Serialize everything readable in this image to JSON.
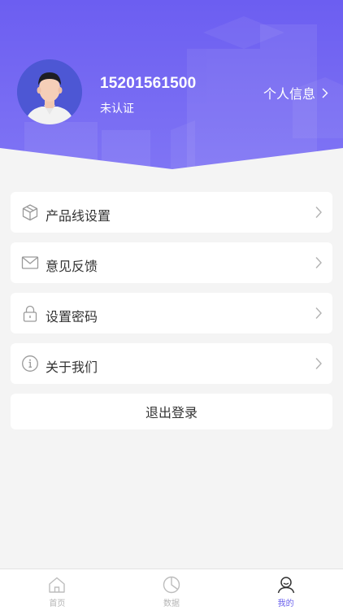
{
  "colors": {
    "accent": "#6a61ec",
    "header_top": "#6f61f2",
    "header_bottom": "#7c72f3"
  },
  "profile": {
    "phone": "15201561500",
    "status": "未认证",
    "info_link": "个人信息",
    "avatar_icon": "avatar"
  },
  "menu": {
    "items": [
      {
        "label": "产品线设置",
        "icon": "cube-icon"
      },
      {
        "label": "意见反馈",
        "icon": "mail-icon"
      },
      {
        "label": "设置密码",
        "icon": "lock-icon"
      },
      {
        "label": "关于我们",
        "icon": "info-icon"
      }
    ]
  },
  "logout_label": "退出登录",
  "tabbar": {
    "tabs": [
      {
        "label": "首页",
        "icon": "home-icon",
        "active": false
      },
      {
        "label": "数据",
        "icon": "pie-chart-icon",
        "active": false
      },
      {
        "label": "我的",
        "icon": "user-icon",
        "active": true
      }
    ]
  }
}
